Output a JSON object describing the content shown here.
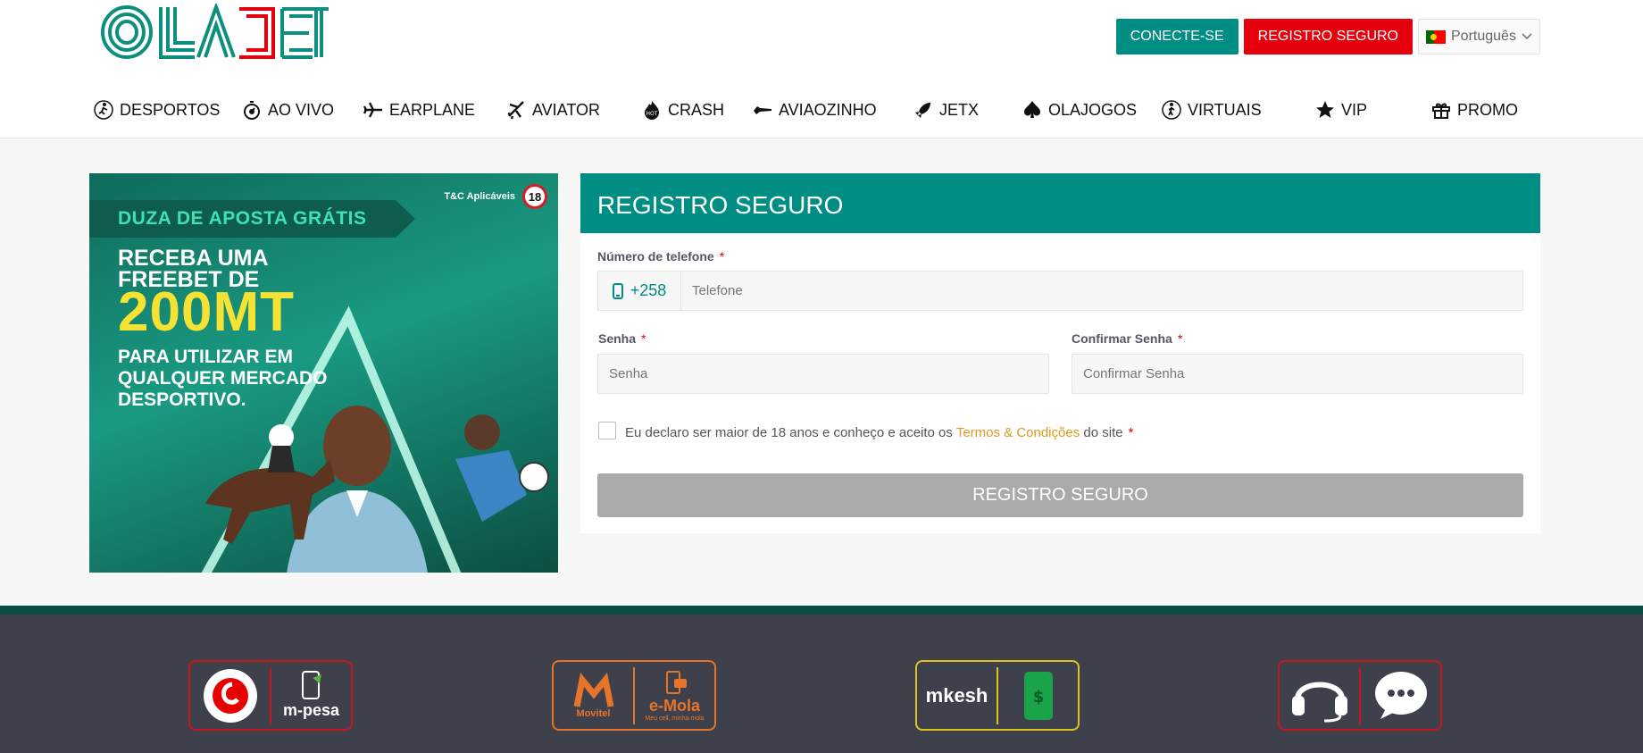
{
  "header": {
    "logo_text": "OLABET",
    "connect_label": "CONECTE-SE",
    "register_label": "REGISTRO SEGURO",
    "language": "Português"
  },
  "nav": [
    {
      "label": "DESPORTOS",
      "icon": "soccer-player-icon"
    },
    {
      "label": "AO VIVO",
      "icon": "stopwatch-icon"
    },
    {
      "label": "EARPLANE",
      "icon": "airplane-icon"
    },
    {
      "label": "AVIATOR",
      "icon": "airplane-tilted-icon"
    },
    {
      "label": "CRASH",
      "icon": "hot-fire-icon"
    },
    {
      "label": "AVIAOZINHO",
      "icon": "jet-icon"
    },
    {
      "label": "JETX",
      "icon": "rocket-icon"
    },
    {
      "label": "OLAJOGOS",
      "icon": "spade-icon"
    },
    {
      "label": "VIRTUAIS",
      "icon": "virtual-runner-icon"
    },
    {
      "label": "VIP",
      "icon": "star-icon"
    },
    {
      "label": "PROMO",
      "icon": "gift-icon"
    }
  ],
  "banner": {
    "ribbon": "DUZA DE APOSTA GRÁTIS",
    "tc": "T&C Aplicáveis",
    "age": "18",
    "line1a": "RECEBA UMA",
    "line1b": "FREEBET DE",
    "amount": "200MT",
    "line3a": "PARA UTILIZAR EM",
    "line3b": "QUALQUER MERCADO",
    "line3c": "DESPORTIVO."
  },
  "form": {
    "title": "REGISTRO SEGURO",
    "phone_label": "Número de telefone",
    "phone_prefix": "+258",
    "phone_placeholder": "Telefone",
    "password_label": "Senha",
    "password_placeholder": "Senha",
    "confirm_label": "Confirmar Senha",
    "confirm_placeholder": "Confirmar Senha",
    "required_mark": "*",
    "terms_before": "Eu declaro ser maior de 18 anos e conheço e aceito os",
    "terms_link": "Termos & Condições",
    "terms_after": "do site",
    "submit_label": "REGISTRO SEGURO"
  },
  "footer": {
    "payments": [
      {
        "name": "m-pesa",
        "brand": "vodafone",
        "color": "#c8151b"
      },
      {
        "name": "e-Mola",
        "brand": "Movitel",
        "tagline": "Meu cell, minha mola",
        "color": "#e8742a"
      },
      {
        "name": "mkesh",
        "color": "#e1c21f"
      },
      {
        "name": "support",
        "color": "#c8151b"
      }
    ]
  },
  "colors": {
    "brand_teal": "#008d84",
    "brand_red": "#e5000e",
    "submit_disabled": "#aaaaaa"
  }
}
